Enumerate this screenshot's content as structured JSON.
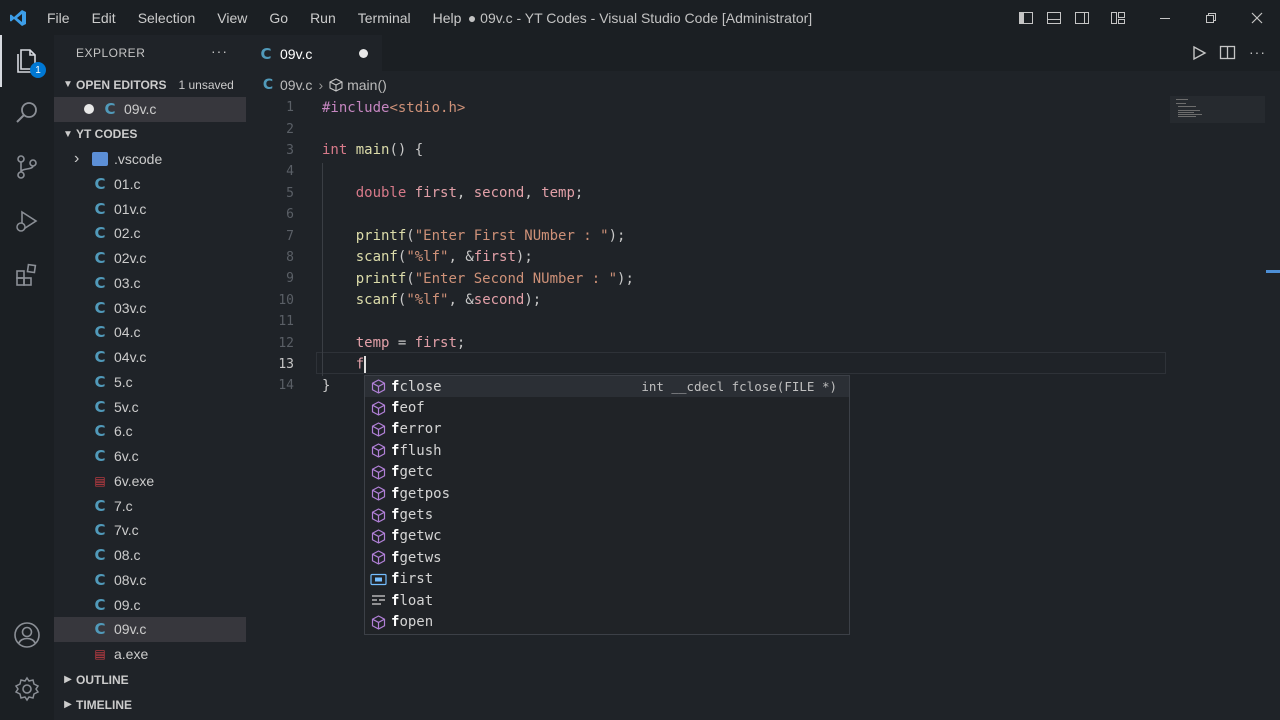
{
  "window": {
    "title": "● 09v.c - YT Codes - Visual Studio Code [Administrator]",
    "menu": [
      "File",
      "Edit",
      "Selection",
      "View",
      "Go",
      "Run",
      "Terminal",
      "Help"
    ],
    "accent": "#0078d4"
  },
  "activity": {
    "explorer_badge": "1",
    "icons": [
      "files-icon",
      "search-icon",
      "source-control-icon",
      "run-debug-icon",
      "extensions-icon",
      "account-icon",
      "settings-gear-icon"
    ]
  },
  "sidebar": {
    "title": "EXPLORER",
    "more": "···",
    "open_editors": {
      "label": "OPEN EDITORS",
      "unsaved": "1 unsaved",
      "items": [
        {
          "name": "09v.c",
          "icon": "c-file-icon"
        }
      ]
    },
    "workspace": {
      "label": "YT CODES",
      "items": [
        {
          "name": ".vscode",
          "icon": "vscode-folder-icon"
        },
        {
          "name": "01.c",
          "icon": "c-file-icon"
        },
        {
          "name": "01v.c",
          "icon": "c-file-icon"
        },
        {
          "name": "02.c",
          "icon": "c-file-icon"
        },
        {
          "name": "02v.c",
          "icon": "c-file-icon"
        },
        {
          "name": "03.c",
          "icon": "c-file-icon"
        },
        {
          "name": "03v.c",
          "icon": "c-file-icon"
        },
        {
          "name": "04.c",
          "icon": "c-file-icon"
        },
        {
          "name": "04v.c",
          "icon": "c-file-icon"
        },
        {
          "name": "5.c",
          "icon": "c-file-icon"
        },
        {
          "name": "5v.c",
          "icon": "c-file-icon"
        },
        {
          "name": "6.c",
          "icon": "c-file-icon"
        },
        {
          "name": "6v.c",
          "icon": "c-file-icon"
        },
        {
          "name": "6v.exe",
          "icon": "exe-file-icon"
        },
        {
          "name": "7.c",
          "icon": "c-file-icon"
        },
        {
          "name": "7v.c",
          "icon": "c-file-icon"
        },
        {
          "name": "08.c",
          "icon": "c-file-icon"
        },
        {
          "name": "08v.c",
          "icon": "c-file-icon"
        },
        {
          "name": "09.c",
          "icon": "c-file-icon"
        },
        {
          "name": "09v.c",
          "icon": "c-file-icon",
          "selected": true
        },
        {
          "name": "a.exe",
          "icon": "exe-file-icon"
        }
      ]
    },
    "outline_label": "OUTLINE",
    "timeline_label": "TIMELINE"
  },
  "tab": {
    "name": "09v.c",
    "dirty": true
  },
  "breadcrumb": {
    "file": "09v.c",
    "symbol": "main()"
  },
  "editor": {
    "current_line": 13,
    "lines": [
      {
        "n": "1",
        "tokens": [
          [
            "pp",
            "#include"
          ],
          [
            "str",
            "<stdio.h>"
          ]
        ]
      },
      {
        "n": "2",
        "tokens": []
      },
      {
        "n": "3",
        "tokens": [
          [
            "type",
            "int"
          ],
          [
            "punc",
            " "
          ],
          [
            "fn",
            "main"
          ],
          [
            "punc",
            "() {"
          ]
        ]
      },
      {
        "n": "4",
        "tokens": []
      },
      {
        "n": "5",
        "tokens": [
          [
            "punc",
            "    "
          ],
          [
            "type",
            "double"
          ],
          [
            "punc",
            " "
          ],
          [
            "var",
            "first"
          ],
          [
            "punc",
            ", "
          ],
          [
            "var",
            "second"
          ],
          [
            "punc",
            ", "
          ],
          [
            "var",
            "temp"
          ],
          [
            "punc",
            ";"
          ]
        ]
      },
      {
        "n": "6",
        "tokens": []
      },
      {
        "n": "7",
        "tokens": [
          [
            "punc",
            "    "
          ],
          [
            "fn",
            "printf"
          ],
          [
            "punc",
            "("
          ],
          [
            "str",
            "\"Enter First NUmber : \""
          ],
          [
            "punc",
            ");"
          ]
        ]
      },
      {
        "n": "8",
        "tokens": [
          [
            "punc",
            "    "
          ],
          [
            "fn",
            "scanf"
          ],
          [
            "punc",
            "("
          ],
          [
            "str",
            "\"%lf\""
          ],
          [
            "punc",
            ", &"
          ],
          [
            "var",
            "first"
          ],
          [
            "punc",
            ");"
          ]
        ]
      },
      {
        "n": "9",
        "tokens": [
          [
            "punc",
            "    "
          ],
          [
            "fn",
            "printf"
          ],
          [
            "punc",
            "("
          ],
          [
            "str",
            "\"Enter Second NUmber : \""
          ],
          [
            "punc",
            ");"
          ]
        ]
      },
      {
        "n": "10",
        "tokens": [
          [
            "punc",
            "    "
          ],
          [
            "fn",
            "scanf"
          ],
          [
            "punc",
            "("
          ],
          [
            "str",
            "\"%lf\""
          ],
          [
            "punc",
            ", &"
          ],
          [
            "var",
            "second"
          ],
          [
            "punc",
            ");"
          ]
        ]
      },
      {
        "n": "11",
        "tokens": []
      },
      {
        "n": "12",
        "tokens": [
          [
            "punc",
            "    "
          ],
          [
            "var",
            "temp"
          ],
          [
            "punc",
            " = "
          ],
          [
            "var",
            "first"
          ],
          [
            "punc",
            ";"
          ]
        ]
      },
      {
        "n": "13",
        "tokens": [
          [
            "punc",
            "    "
          ],
          [
            "var",
            "f"
          ]
        ]
      },
      {
        "n": "14",
        "tokens": [
          [
            "punc",
            "}"
          ]
        ]
      }
    ]
  },
  "suggest": {
    "detail": "int __cdecl fclose(FILE *)",
    "items": [
      {
        "match": "f",
        "rest": "close",
        "icon": "method-icon",
        "selected": true
      },
      {
        "match": "f",
        "rest": "eof",
        "icon": "method-icon"
      },
      {
        "match": "f",
        "rest": "error",
        "icon": "method-icon"
      },
      {
        "match": "f",
        "rest": "flush",
        "icon": "method-icon"
      },
      {
        "match": "f",
        "rest": "getc",
        "icon": "method-icon"
      },
      {
        "match": "f",
        "rest": "getpos",
        "icon": "method-icon"
      },
      {
        "match": "f",
        "rest": "gets",
        "icon": "method-icon"
      },
      {
        "match": "f",
        "rest": "getwc",
        "icon": "method-icon"
      },
      {
        "match": "f",
        "rest": "getws",
        "icon": "method-icon"
      },
      {
        "match": "f",
        "rest": "irst",
        "icon": "variable-icon"
      },
      {
        "match": "f",
        "rest": "loat",
        "icon": "keyword-icon"
      },
      {
        "match": "f",
        "rest": "open",
        "icon": "method-icon"
      }
    ]
  }
}
